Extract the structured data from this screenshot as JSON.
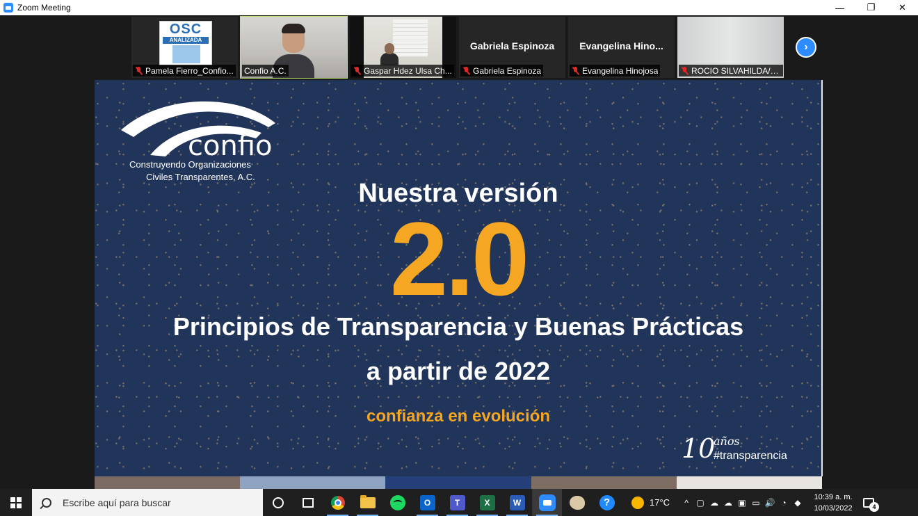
{
  "window": {
    "title": "Zoom Meeting",
    "minimize": "—",
    "restore": "❐",
    "close": "✕"
  },
  "gallery": {
    "participants": [
      {
        "name": "Pamela Fierro_Confio...",
        "muted": true
      },
      {
        "name": "Confio A.C.",
        "muted": false,
        "active": true
      },
      {
        "name": "Gaspar Hdez Ulsa Ch...",
        "muted": true
      },
      {
        "name": "Gabriela Espinoza",
        "muted": true,
        "display_name": "Gabriela Espinoza"
      },
      {
        "name": "Evangelina Hinojosa",
        "muted": true,
        "display_name": "Evangelina  Hino..."
      },
      {
        "name": "ROCIO SILVAHILDA/E...",
        "muted": true
      }
    ],
    "osc_logo": {
      "top": "OSC",
      "bottom": "ANALIZADA"
    },
    "next_arrow": "›"
  },
  "slide": {
    "logo_word": "confio",
    "logo_sub1": "Construyendo Organizaciones",
    "logo_sub2": "Civiles Transparentes, A.C.",
    "heading": "Nuestra versión",
    "version": "2.0",
    "subtitle": "Principios de Transparencia y Buenas Prácticas",
    "subtitle2": "a partir de 2022",
    "tagline": "confianza en evolución",
    "anniversary_number": "10",
    "anniversary_years": "años",
    "anniversary_hashtag": "#transparencia",
    "colors": {
      "background": "#21355a",
      "accent": "#f5a623"
    },
    "strip_colors": [
      "#7a6a63",
      "#8ea3c2",
      "#243f7a",
      "#7e6d62",
      "#e8e4df"
    ]
  },
  "taskbar": {
    "search_placeholder": "Escribe aquí para buscar",
    "apps": [
      "cortana-icon",
      "task-view-icon",
      "chrome-icon",
      "file-explorer-icon",
      "spotify-icon",
      "outlook-icon",
      "teams-icon",
      "excel-icon",
      "word-icon",
      "zoom-icon",
      "paint-icon",
      "help-icon"
    ],
    "outlook_label": "O",
    "teams_label": "T",
    "excel_label": "X",
    "word_label": "W",
    "help_label": "?",
    "weather": "17°C",
    "tray": {
      "chevron": "^",
      "volume": "🔊"
    },
    "time": "10:39 a. m.",
    "date": "10/03/2022",
    "notifications": "4"
  }
}
